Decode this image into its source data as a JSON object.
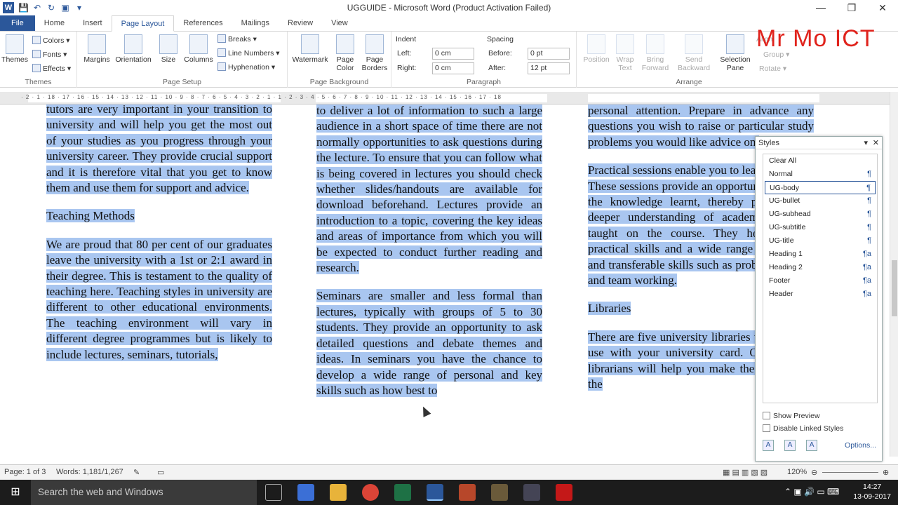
{
  "window": {
    "title": "UGGUIDE - Microsoft Word (Product Activation Failed)",
    "app_icon": "W"
  },
  "ribbon_tabs": [
    "File",
    "Home",
    "Insert",
    "Page Layout",
    "References",
    "Mailings",
    "Review",
    "View"
  ],
  "ribbon": {
    "themes": {
      "big": "Themes",
      "colors": "Colors",
      "fonts": "Fonts",
      "effects": "Effects",
      "label": "Themes"
    },
    "page_setup": {
      "margins": "Margins",
      "orientation": "Orientation",
      "size": "Size",
      "columns": "Columns",
      "breaks": "Breaks",
      "line_numbers": "Line Numbers",
      "hyphenation": "Hyphenation",
      "label": "Page Setup"
    },
    "page_background": {
      "watermark": "Watermark",
      "page_color": "Page Color",
      "page_borders": "Page Borders",
      "label": "Page Background"
    },
    "paragraph": {
      "indent": "Indent",
      "left_label": "Left:",
      "left_val": "0 cm",
      "right_label": "Right:",
      "right_val": "0 cm",
      "spacing": "Spacing",
      "before_label": "Before:",
      "before_val": "0 pt",
      "after_label": "After:",
      "after_val": "12 pt",
      "label": "Paragraph"
    },
    "arrange": {
      "position": "Position",
      "wrap": "Wrap Text",
      "bring": "Bring Forward",
      "send": "Send Backward",
      "selection": "Selection Pane",
      "align": "Align",
      "group": "Group",
      "rotate": "Rotate",
      "label": "Arrange"
    }
  },
  "overlay_text": "Mr Mo ICT",
  "ruler_numbers": "· 2 · 1 · 18 · 17 · 16 · 15 · 14 · 13 · 12 · 11 · 10 · 9 · 8 · 7 · 6 · 5 · 4 · 3 · 2 · 1 · 1 · 2 · 3 · 4 · 5 · 6 · 7 · 8 · 9 · 10 · 11 · 12 · 13 · 14 · 15 · 16 · 17 · 18",
  "columns": {
    "col1": {
      "p1": "tutors are very important in your transition to university and will help you get the most out of your studies as you progress through your university career. They provide crucial support and it is therefore vital that you get to know them and use them for support and advice.",
      "h1": "Teaching Methods",
      "p2": "We are proud that 80 per cent of our graduates leave the university with a 1st or 2:1 award in their degree. This is testament to the quality of teaching here. Teaching styles in university are different to other educational environments. The teaching environment will vary in different degree programmes but is likely to include lectures, seminars, tutorials,"
    },
    "col2": {
      "p1": "to deliver a lot of information to such a large audience in a short space of time there are not normally opportunities to ask questions during the lecture. To ensure that you can follow what is being covered in lectures you should check whether slides/handouts are available for download beforehand. Lectures provide an introduction to a topic, covering the key ideas and areas of importance from which you will be expected to conduct further reading and research.",
      "p2": "Seminars are smaller and less formal than lectures, typically with groups of 5 to 30 students. They provide an opportunity to ask detailed questions and debate themes and ideas. In seminars you have the chance to develop a wide range of personal and key skills such as how best to"
    },
    "col3": {
      "p1": "personal attention. Prepare in advance any questions you wish to raise or particular study problems you would like advice on.",
      "p2": "Practical sessions enable you to learn by doing. These sessions provide an opportunity to apply the knowledge learnt, thereby promoting a deeper understanding of academic subjects taught on the course. They help develop practical skills and a wide range of personal and transferable skills such as problem solving and team working.",
      "h1": "Libraries",
      "p3": "There are five university libraries that you can use with your university card. Our team of librarians will help you make the best use of the"
    }
  },
  "styles_pane": {
    "title": "Styles",
    "items": [
      {
        "name": "Clear All",
        "mark": ""
      },
      {
        "name": "Normal",
        "mark": "¶"
      },
      {
        "name": "UG-body",
        "mark": "¶"
      },
      {
        "name": "UG-bullet",
        "mark": "¶"
      },
      {
        "name": "UG-subhead",
        "mark": "¶"
      },
      {
        "name": "UG-subtitle",
        "mark": "¶"
      },
      {
        "name": "UG-title",
        "mark": "¶"
      },
      {
        "name": "Heading 1",
        "mark": "¶a"
      },
      {
        "name": "Heading 2",
        "mark": "¶a"
      },
      {
        "name": "Footer",
        "mark": "¶a"
      },
      {
        "name": "Header",
        "mark": "¶a"
      }
    ],
    "show_preview": "Show Preview",
    "disable_linked": "Disable Linked Styles",
    "options": "Options..."
  },
  "status": {
    "page": "Page: 1 of 3",
    "words": "Words: 1,181/1,267",
    "zoom": "120%"
  },
  "taskbar": {
    "search": "Search the web and Windows",
    "time": "14:27",
    "date": "13-09-2017"
  }
}
